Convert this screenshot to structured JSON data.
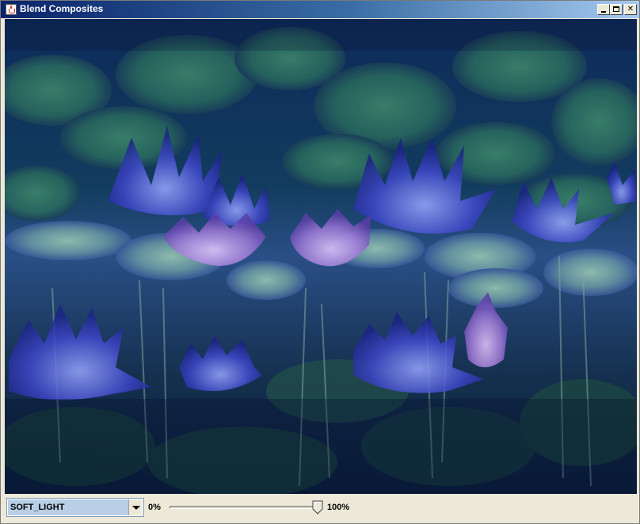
{
  "window": {
    "title": "Blend Composites"
  },
  "controls": {
    "blend_mode": {
      "selected": "SOFT_LIGHT"
    },
    "opacity_slider": {
      "min_label": "0%",
      "max_label": "100%",
      "value_percent": 100
    }
  },
  "canvas": {
    "description_icons": [
      "blended-image"
    ],
    "colors": {
      "deep_blue": "#0b1a5a",
      "teal": "#1f6e6a",
      "green": "#4f8a5a",
      "violet": "#5b4ad6",
      "pink": "#c48be0"
    }
  }
}
